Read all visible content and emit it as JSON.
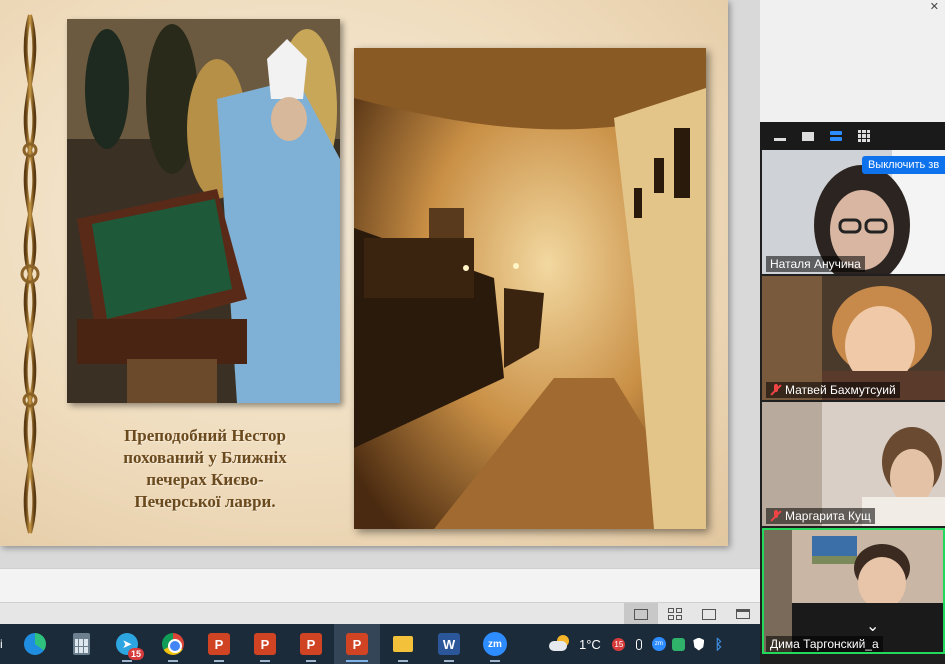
{
  "slide": {
    "caption_lines": [
      "Преподобний Нестор",
      "похований у Ближніх",
      "печерах Києво-",
      "Печерської лаври."
    ]
  },
  "zoom": {
    "mute_all_button": "Выключить зв",
    "participants": [
      {
        "name": "Наталя Анучина",
        "muted": false
      },
      {
        "name": "Матвей Бахмутсуий",
        "muted": true
      },
      {
        "name": "Маргарита Кущ",
        "muted": true
      },
      {
        "name": "Дима Таргонский_а",
        "muted": false,
        "active_speaker": true
      }
    ]
  },
  "taskbar": {
    "telegram_badge": "15",
    "ppt_letter": "P",
    "word_letter": "W",
    "zoom_label": "zm"
  },
  "tray": {
    "temperature": "1°C",
    "notification_badge": "15",
    "zoom_label": "zm"
  },
  "colors": {
    "caption": "#6b4a1d",
    "zoom_blue": "#0e72ed",
    "active_speaker_border": "#23d95b",
    "taskbar": "#1c2b3a"
  }
}
